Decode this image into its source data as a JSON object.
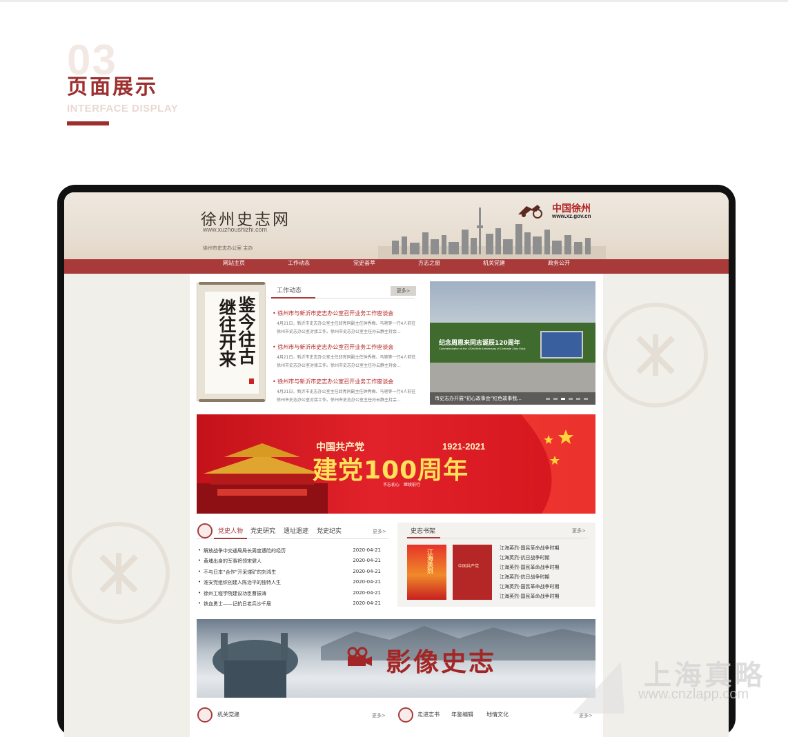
{
  "section": {
    "number": "03",
    "title": "页面展示",
    "subtitle": "INTERFACE DISPLAY"
  },
  "site": {
    "logo": "徐州史志网",
    "url": "www.xuzhoushizhi.com",
    "host": "徐州市史志办公室 主办",
    "gov_name": "中国徐州",
    "gov_url": "www.xz.gov.cn"
  },
  "nav": [
    "网站主页",
    "工作动态",
    "党史荟萃",
    "方志之窗",
    "机关党建",
    "政务公开"
  ],
  "scroll": {
    "col1": "继往开来",
    "col2": "鉴今往古"
  },
  "news": {
    "tab": "工作动态",
    "more": "更多>",
    "items": [
      {
        "title": "• 徐州市与新沂市史志办公室召开业务工作座谈会",
        "desc1": "4月21日，新沂市史志办公室主任邱亮同副主任钟秀梅、马艳等一行4人前往",
        "desc2": "徐州市史志办公室对接工作。徐州市史志办公室主任孙云静主持会..."
      },
      {
        "title": "• 徐州市与新沂市史志办公室召开业务工作座谈会",
        "desc1": "4月21日，新沂市史志办公室主任邱亮同副主任钟秀梅、马艳等一行4人前往",
        "desc2": "徐州市史志办公室对接工作。徐州市史志办公室主任孙云静主持会..."
      },
      {
        "title": "• 徐州市与新沂市史志办公室召开业务工作座谈会",
        "desc1": "4月21日，新沂市史志办公室主任邱亮同副主任钟秀梅、马艳等一行4人前往",
        "desc2": "徐州市史志办公室对接工作。徐州市史志办公室主任孙云静主持会..."
      }
    ]
  },
  "photo": {
    "caption": "市史志办开展“初心故事会”红色故事我...",
    "billboard": "纪念周恩来同志诞辰120周年",
    "billboard_en": "Commemoration of the 120th Birth Anniversary of Comrade Zhou Enlai"
  },
  "banner": {
    "small": "中国共产党",
    "big": "建党100周年",
    "years": "1921-2021",
    "motto": "不忘初心　继续前行"
  },
  "history": {
    "tabs": [
      "党史人物",
      "党史研究",
      "遗址遗迹",
      "党史纪实"
    ],
    "more": "更多>",
    "rows": [
      {
        "title": "解放战争中交通局局长周度遇险的经历",
        "date": "2020-04-21"
      },
      {
        "title": "黄埔出身的军事将领宋健人",
        "date": "2020-04-21"
      },
      {
        "title": "不与日本“合作”开采煤矿的刘鸿生",
        "date": "2020-04-21"
      },
      {
        "title": "淮安党组织创建人陈治平的独特人生",
        "date": "2020-04-21"
      },
      {
        "title": "徐州工程学院建设功臣曹振涛",
        "date": "2020-04-21"
      },
      {
        "title": "铁血勇士——记抗日老兵沙千居",
        "date": "2020-04-21"
      }
    ]
  },
  "shelf": {
    "tab": "史志书架",
    "more": "更多>",
    "book1": "江海英烈",
    "book2": "中国共产党",
    "items": [
      "江海英烈-国民革命战争时期",
      "江海英烈-抗日战争时期",
      "江海英烈-国民革命战争时期",
      "江海英烈-抗日战争时期",
      "江海英烈-国民革命战争时期",
      "江海英烈-国民革命战争时期"
    ]
  },
  "banner2": {
    "title": "影像史志"
  },
  "footer_tabs": {
    "left": "机关党建",
    "left_more": "更多>",
    "right": [
      "走进志书",
      "年鉴编辑",
      "地情文化"
    ],
    "right_more": "更多>"
  },
  "watermark": {
    "cn": "上海真略",
    "url": "www.cnzlapp.com"
  },
  "colors": {
    "accent": "#9e2f2f",
    "nav": "#a83a3a",
    "banner_red": "#d4151c",
    "gold": "#ffe15a"
  }
}
